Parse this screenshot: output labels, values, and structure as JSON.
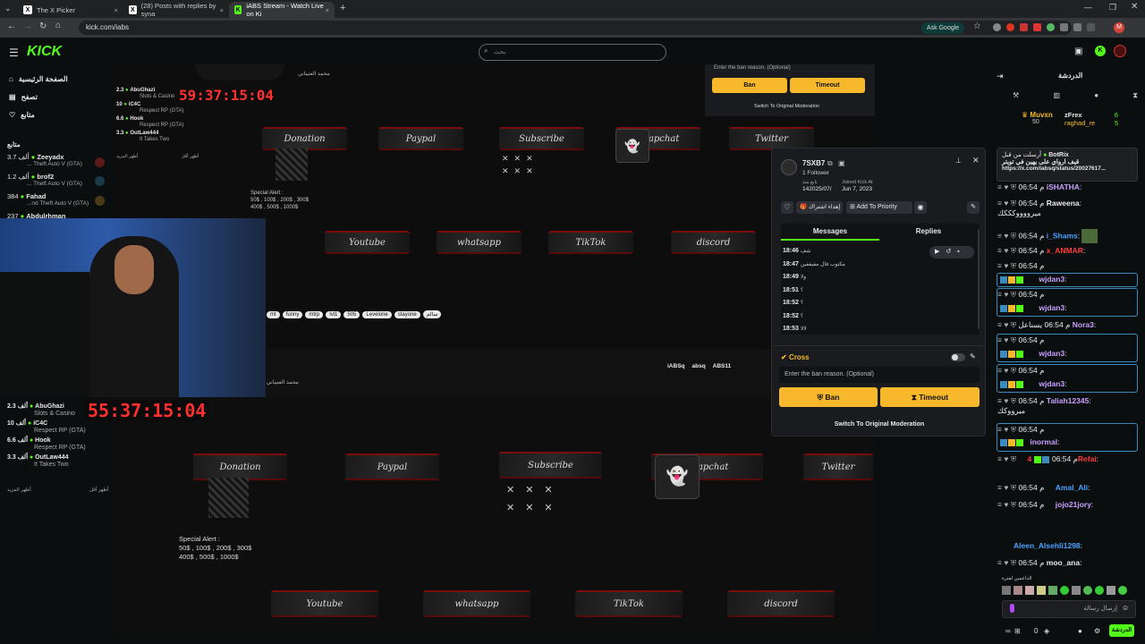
{
  "browser": {
    "tabs": [
      {
        "title": "The X Picker"
      },
      {
        "title": "(28) Posts with replies by syna"
      },
      {
        "title": "iABS Stream - Watch Live on Ki"
      }
    ],
    "url": "kick.com/iabs",
    "ask_google": "Ask Google"
  },
  "header": {
    "logo": "KICK",
    "search_placeholder": "بحث"
  },
  "sidebar": {
    "nav": [
      "الصفحة الرئيسية",
      "تصفح",
      "متابع"
    ],
    "following_title": "متابع",
    "channels": [
      {
        "name": "Zeeyadx",
        "viewers": "3.7 ألف",
        "game": "... Theft Auto V (GTA)"
      },
      {
        "name": "brof2",
        "viewers": "1.2 ألف",
        "game": "... Theft Auto V (GTA)"
      },
      {
        "name": "Fahad",
        "viewers": "384",
        "game": "...nd Theft Auto V (GTA)"
      },
      {
        "name": "Abdulrhman",
        "viewers": "237",
        "game": ""
      }
    ]
  },
  "stream": {
    "top_overlay": {
      "timer": "59:37:15:04",
      "list": [
        {
          "name": "AbuGhazi",
          "value": "2.3",
          "sub": "Slots & Casino"
        },
        {
          "name": "iC4C",
          "value": "10",
          "sub": "Respect RP (GTA)"
        },
        {
          "name": "Hook",
          "value": "6.6",
          "sub": "Respect RP (GTA)"
        },
        {
          "name": "OutLaw444",
          "value": "3.3",
          "sub": "It Takes Two"
        }
      ],
      "more_left": "أظهر المزيد",
      "more_right": "أظهر أقل",
      "streamer_line": "محمد العتيباني",
      "special_alert": "Special Alert :",
      "special_line1": "50$ , 100$ , 200$ , 300$",
      "special_line2": "400$ , 500$ , 1000$",
      "panels_row1": [
        "Donation",
        "Paypal",
        "Subscribe",
        "Snapchat",
        "Twitter"
      ],
      "panels_row2": [
        "Youtube",
        "whatsapp",
        "TikTok",
        "discord"
      ],
      "tags": [
        "mt",
        "funny",
        "mtrp",
        "lvl1",
        "505",
        "Levelone",
        "stayone",
        "سالم"
      ]
    },
    "bottom_overlay": {
      "timer": "55:37:15:04",
      "list": [
        {
          "name": "AbuGhazi",
          "value": "2.3 ألف",
          "sub": "Slots & Casino"
        },
        {
          "name": "iC4C",
          "value": "10 ألف",
          "sub": "Respect RP (GTA)"
        },
        {
          "name": "Hook",
          "value": "6.6 ألف",
          "sub": "Respect RP (GTA)"
        },
        {
          "name": "OutLaw444",
          "value": "3.3 ألف",
          "sub": "It Takes Two"
        }
      ],
      "more_left": "أظهر المزيد",
      "more_right": "أظهر أقل",
      "streamer_line": "محمد العتيباني",
      "socials": [
        "iABSq",
        "absq",
        "ABS11"
      ],
      "special_alert": "Special Alert :",
      "special_line1": "50$ , 100$ , 200$ , 300$",
      "special_line2": "400$ , 500$ , 1000$",
      "panels_row1": [
        "Donation",
        "Paypal",
        "Subscribe",
        "Snapchat",
        "Twitter"
      ],
      "panels_row2": [
        "Youtube",
        "whatsapp",
        "TikTok",
        "discord"
      ]
    },
    "bg_mod": {
      "ban_reason": "Enter the ban reason. (Optional)",
      "ban": "Ban",
      "timeout": "Timeout",
      "switch": "Switch To Original Moderation"
    }
  },
  "mod_popup": {
    "username": "7SXB7",
    "followers": "1 Follower",
    "followed_label": "تابع منذ",
    "followed_date": "142025/07/",
    "joined_label": "Joined Kick At",
    "joined_date": "Jun 7, 2023",
    "sub_button": "إهداء اشتراك",
    "priority_button": "Add To Priority",
    "tabs": [
      "Messages",
      "Replies"
    ],
    "messages": [
      {
        "time": "18:46",
        "text": "شف"
      },
      {
        "time": "18:47",
        "text": "مكتوب قال مقيقفين"
      },
      {
        "time": "18:49",
        "text": "ولا"
      },
      {
        "time": "18:51",
        "text": "؟"
      },
      {
        "time": "18:52",
        "text": "؟"
      },
      {
        "time": "18:52",
        "text": "؟"
      },
      {
        "time": "18:53",
        "text": "لالا"
      }
    ],
    "cross_label": "Cross",
    "ban_reason": "Enter the ban reason. (Optional)",
    "ban": "Ban",
    "timeout": "Timeout",
    "switch": "Switch To Original Moderation"
  },
  "chat": {
    "title": "الدردشة",
    "top_users": [
      {
        "name": "Muvxn",
        "count": "50"
      },
      {
        "name": "zFrex",
        "count": "6"
      },
      {
        "name": "raghad_re",
        "count": "5"
      }
    ],
    "pinned_user": "BotRix",
    "pinned_label": "أرسلت من قبل",
    "pinned_text": "قيف ارواي على يهين في تويتر",
    "pinned_link": "https://x.com/iabsq/status/20027617...",
    "messages": [
      {
        "time": "م 06:54",
        "user": "iSHATHA",
        "color": "#c9a0ff",
        "text": ""
      },
      {
        "time": "م 06:54",
        "user": "Raweena",
        "color": "#e0e0e0",
        "text": "ميرووووكككك"
      },
      {
        "time": "م 06:54",
        "user": "i_Shams",
        "color": "#4aa3ff",
        "text": ""
      },
      {
        "time": "م 06:54",
        "user": "x_ANMAR",
        "color": "#ff3b3b",
        "text": ""
      },
      {
        "time": "م 06:54",
        "user": "wjdan3",
        "color": "#c9a0ff",
        "text": ""
      },
      {
        "time": "م 06:54",
        "user": "wjdan3",
        "color": "#c9a0ff",
        "text": ""
      },
      {
        "time": "م 06:54",
        "user": "Nora3",
        "color": "#c9a0ff",
        "text": "يسناعل"
      },
      {
        "time": "م 06:54",
        "user": "wjdan3",
        "color": "#c9a0ff",
        "text": ""
      },
      {
        "time": "م 06:54",
        "user": "wjdan3",
        "color": "#c9a0ff",
        "text": ""
      },
      {
        "time": "م 06:54",
        "user": "Taliah12345",
        "color": "#c9a0ff",
        "text": "ميرووكك"
      },
      {
        "time": "م 06:54",
        "user": "inormal",
        "color": "#c9a0ff",
        "text": ""
      },
      {
        "time": "م 06:54",
        "user": "4Refai",
        "color": "#ff3b3b",
        "text": ""
      },
      {
        "time": "م 06:54",
        "user": "Amal_Ali",
        "color": "#4aa3ff",
        "text": ""
      },
      {
        "time": "م 06:54",
        "user": "jojo21jory",
        "color": "#c9a0ff",
        "text": ""
      },
      {
        "time": "",
        "user": "Aleen_Alsehli1298",
        "color": "#4aa3ff",
        "text": ""
      },
      {
        "time": "م 06:54",
        "user": "moo_ana",
        "color": "#e0e0e0",
        "text": ""
      }
    ],
    "top_label_top": "الداعمين لفترة",
    "input_placeholder": "إرسال رسالة",
    "count": "0",
    "send": "الدردشة"
  }
}
